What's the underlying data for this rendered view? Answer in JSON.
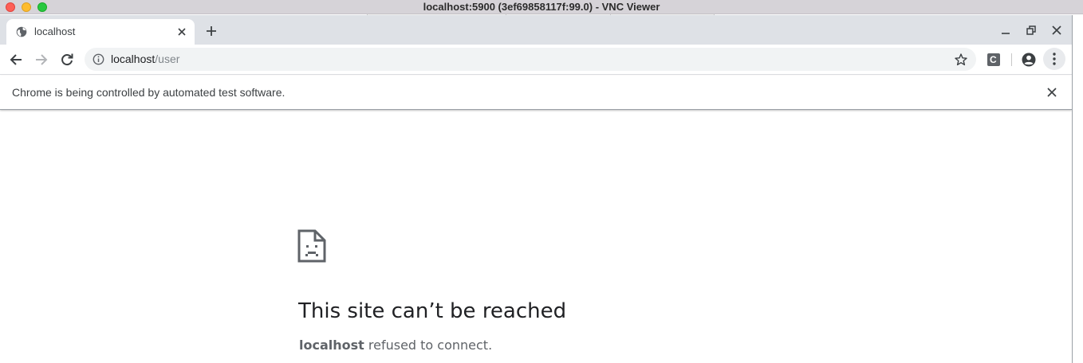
{
  "window": {
    "title": "localhost:5900 (3ef69858117f:99.0) - VNC Viewer"
  },
  "tabs": [
    {
      "title": "localhost",
      "icon": "globe-icon",
      "active": true
    }
  ],
  "toolbar": {
    "url_host": "localhost",
    "url_path": "/user",
    "extension_letter": "C"
  },
  "infobar": {
    "message": "Chrome is being controlled by automated test software."
  },
  "error": {
    "icon": "sad-document-icon",
    "title": "This site can’t be reached",
    "host": "localhost",
    "message": " refused to connect."
  },
  "colors": {
    "traffic_red": "#fe5f57",
    "traffic_yellow": "#febc2e",
    "traffic_green": "#28c840",
    "tabstrip_bg": "#dee1e6",
    "omnibox_bg": "#f1f3f4"
  }
}
